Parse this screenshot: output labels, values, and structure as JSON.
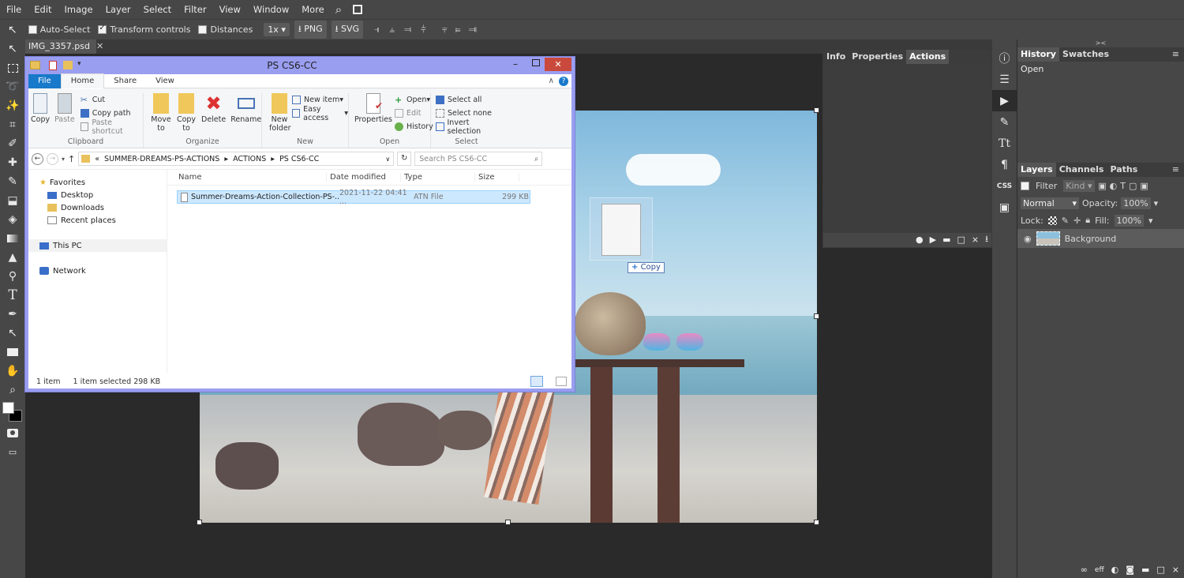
{
  "menu": [
    "File",
    "Edit",
    "Image",
    "Layer",
    "Select",
    "Filter",
    "View",
    "Window",
    "More"
  ],
  "options": {
    "auto_select": "Auto-Select",
    "transform_controls": "Transform controls",
    "distances": "Distances",
    "scale": "1x",
    "png": "PNG",
    "svg": "SVG"
  },
  "document_tab": "IMG_3357.psd",
  "mid_panel_tabs": [
    "Info",
    "Properties",
    "Actions"
  ],
  "right_panel": {
    "tabs_top": [
      "History",
      "Swatches"
    ],
    "history_items": [
      "Open"
    ],
    "tabs_layers": [
      "Layers",
      "Channels",
      "Paths"
    ],
    "filter_label": "Filter",
    "filter_kind": "Kind",
    "blend_mode": "Normal",
    "opacity_label": "Opacity:",
    "opacity_value": "100%",
    "lock_label": "Lock:",
    "fill_label": "Fill:",
    "fill_value": "100%",
    "layer_name": "Background"
  },
  "drag_copy_label": "Copy",
  "explorer": {
    "title": "PS CS6-CC",
    "ribbon_tabs": [
      "File",
      "Home",
      "Share",
      "View"
    ],
    "clipboard": {
      "copy": "Copy",
      "paste": "Paste",
      "cut": "Cut",
      "copy_path": "Copy path",
      "paste_shortcut": "Paste shortcut",
      "label": "Clipboard"
    },
    "organize": {
      "move_to": "Move to",
      "copy_to": "Copy to",
      "delete": "Delete",
      "rename": "Rename",
      "label": "Organize"
    },
    "new": {
      "new_folder": "New folder",
      "new_item": "New item",
      "easy_access": "Easy access",
      "label": "New"
    },
    "open": {
      "properties": "Properties",
      "open": "Open",
      "edit": "Edit",
      "history": "History",
      "label": "Open"
    },
    "select": {
      "select_all": "Select all",
      "select_none": "Select none",
      "invert": "Invert selection",
      "label": "Select"
    },
    "path": [
      "«",
      "SUMMER-DREAMS-PS-ACTIONS",
      "ACTIONS",
      "PS CS6-CC"
    ],
    "search_placeholder": "Search PS CS6-CC",
    "nav": {
      "favorites": "Favorites",
      "desktop": "Desktop",
      "downloads": "Downloads",
      "recent": "Recent places",
      "this_pc": "This PC",
      "network": "Network"
    },
    "columns": [
      "Name",
      "Date modified",
      "Type",
      "Size"
    ],
    "file": {
      "name": "Summer-Dreams-Action-Collection-PS-...",
      "date": "2021-11-22 04:41 ...",
      "type": "ATN File",
      "size": "299 KB"
    },
    "status": {
      "count": "1 item",
      "selected": "1 item selected  298 KB"
    }
  },
  "colors": {
    "ps_bg": "#474747",
    "explorer_frame": "#9a9ef0",
    "file_tab": "#1979ca"
  }
}
